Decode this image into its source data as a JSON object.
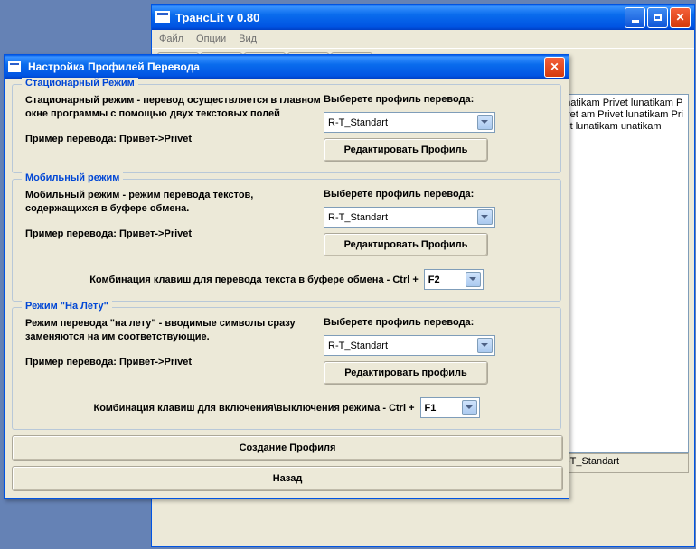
{
  "mainWindow": {
    "title": "ТрансLit v 0.80",
    "menu": [
      "Файл",
      "Опции",
      "Вид"
    ],
    "textarea": "unatikam Privet lunatikam Privet am Privet lunatikam Privet lunatikam unatikam",
    "statusProfile": "R-T_Standart"
  },
  "dialog": {
    "title": "Настройка Профилей Перевода",
    "stationary": {
      "groupTitle": "Стационарный Режим",
      "desc": "Стационарный режим - перевод осуществляется в главном окне программы с помощью двух текстовых полей",
      "example": "Пример перевода:   Привет->Privet",
      "selectLabel": "Выберете профиль перевода:",
      "selectValue": "R-T_Standart",
      "editBtn": "Редактировать Профиль"
    },
    "mobile": {
      "groupTitle": "Мобильный режим",
      "desc": "Мобильный режим - режим перевода текстов, содержащихся в буфере обмена.",
      "example": "Пример перевода:   Привет->Privet",
      "selectLabel": "Выберете профиль перевода:",
      "selectValue": "R-T_Standart",
      "editBtn": "Редактировать Профиль",
      "hotkeyLabel": "Комбинация клавиш для перевода текста в буфере обмена -   Ctrl +",
      "hotkeyValue": "F2"
    },
    "onfly": {
      "groupTitle": "Режим \"На Лету\"",
      "desc": "Режим перевода \"на лету\" - вводимые символы сразу заменяются на им соответствующие.",
      "example": "Пример перевода:   Привет->Privet",
      "selectLabel": "Выберете профиль перевода:",
      "selectValue": "R-T_Standart",
      "editBtn": "Редактировать профиль",
      "hotkeyLabel": "Комбинация клавиш для включения\\выключения режима -   Ctrl +",
      "hotkeyValue": "F1"
    },
    "createBtn": "Создание Профиля",
    "backBtn": "Назад"
  }
}
